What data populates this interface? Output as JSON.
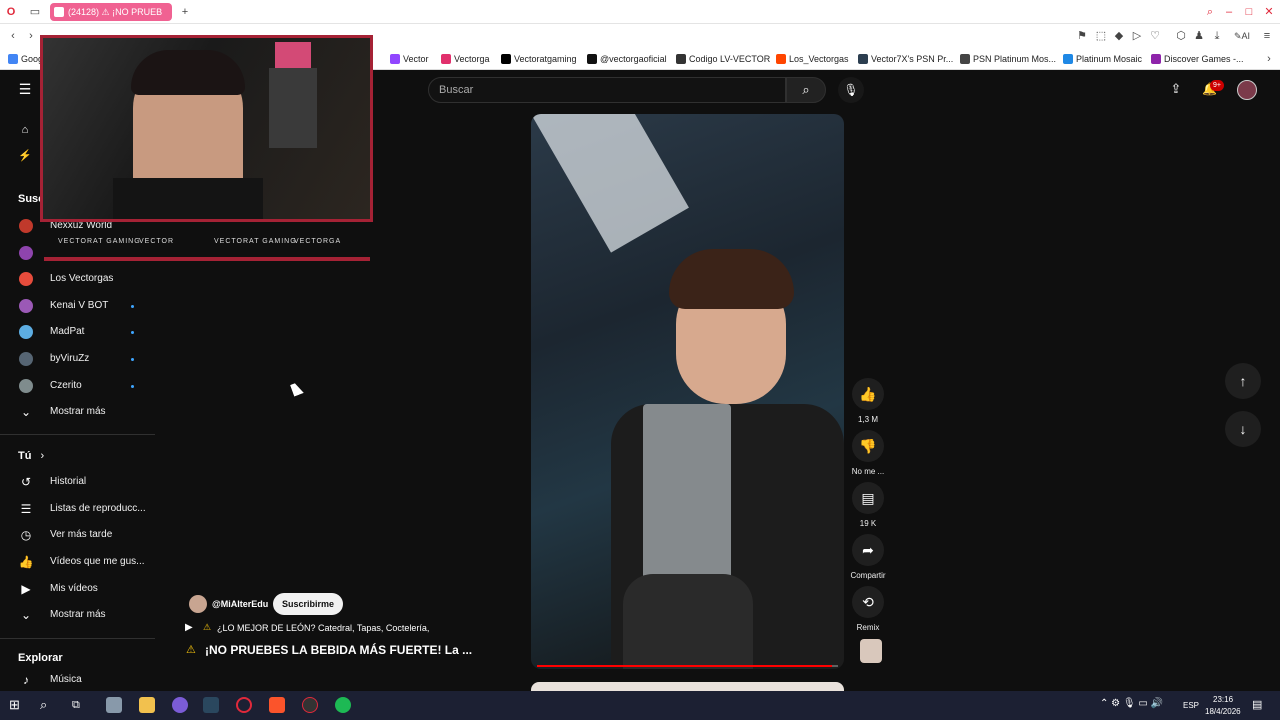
{
  "browser": {
    "active_tab": "(24128) ⚠ ¡NO PRUEB",
    "bookmarks": [
      {
        "label": "Vector",
        "color": "#9146ff"
      },
      {
        "label": "Vectorga",
        "color": "#e1306c"
      },
      {
        "label": "Vectoratgaming",
        "color": "#000000"
      },
      {
        "label": "@vectorgaoficial",
        "color": "#111111"
      },
      {
        "label": "Codigo LV-VECTOR",
        "color": "#333333"
      },
      {
        "label": "Los_Vectorgas",
        "color": "#ff4500"
      },
      {
        "label": "Vector7X's PSN Pr...",
        "color": "#2c3e50"
      },
      {
        "label": "PSN Platinum Mos...",
        "color": "#444444"
      },
      {
        "label": "Platinum Mosaic",
        "color": "#1e88e5"
      },
      {
        "label": "Discover Games -...",
        "color": "#8e24aa"
      }
    ],
    "bookmark_prefix": "Goog"
  },
  "youtube": {
    "search_placeholder": "Buscar",
    "notification_count": "9+",
    "sidebar": {
      "subscriptions_title": "Susc",
      "subscriptions": [
        {
          "label": "Nexxuz World",
          "avatar": "#c0392b",
          "dot": false
        },
        {
          "label": "",
          "avatar": "#8e44ad",
          "dot": false
        },
        {
          "label": "Los Vectorgas",
          "avatar": "#e74c3c",
          "dot": false
        },
        {
          "label": "Kenai V BOT",
          "avatar": "#9b59b6",
          "dot": true
        },
        {
          "label": "MadPat",
          "avatar": "#5dade2",
          "dot": true
        },
        {
          "label": "byViruZz",
          "avatar": "#566573",
          "dot": true
        },
        {
          "label": "Czerito",
          "avatar": "#7f8c8d",
          "dot": true
        }
      ],
      "show_more_1": "Mostrar más",
      "you_title": "Tú",
      "you_items": [
        "Historial",
        "Listas de reproducc...",
        "Ver más tarde",
        "Vídeos que me gus...",
        "Mis vídeos"
      ],
      "show_more_2": "Mostrar más",
      "explore_title": "Explorar",
      "explore_items": [
        "Música"
      ]
    },
    "short": {
      "channel": "@MiAlterEdu",
      "subscribe_label": "Suscribirme",
      "subtitle": "¿LO MEJOR DE LEÓN? Catedral, Tapas, Coctelería,",
      "title": "¡NO PRUEBES LA BEBIDA MÁS FUERTE! La ...",
      "likes": "1,3 M",
      "dislike_label": "No me ...",
      "comments": "19 K",
      "share_label": "Compartir",
      "remix_label": "Remix",
      "progress": 0.98
    }
  },
  "overlay": {
    "socials": [
      "VECTORAT GAMING",
      "VECTOR",
      "VECTORAT GAMING",
      "VECTORGA"
    ]
  },
  "taskbar": {
    "time": "23:16",
    "date": "18/4/2026",
    "lang": "ESP"
  }
}
